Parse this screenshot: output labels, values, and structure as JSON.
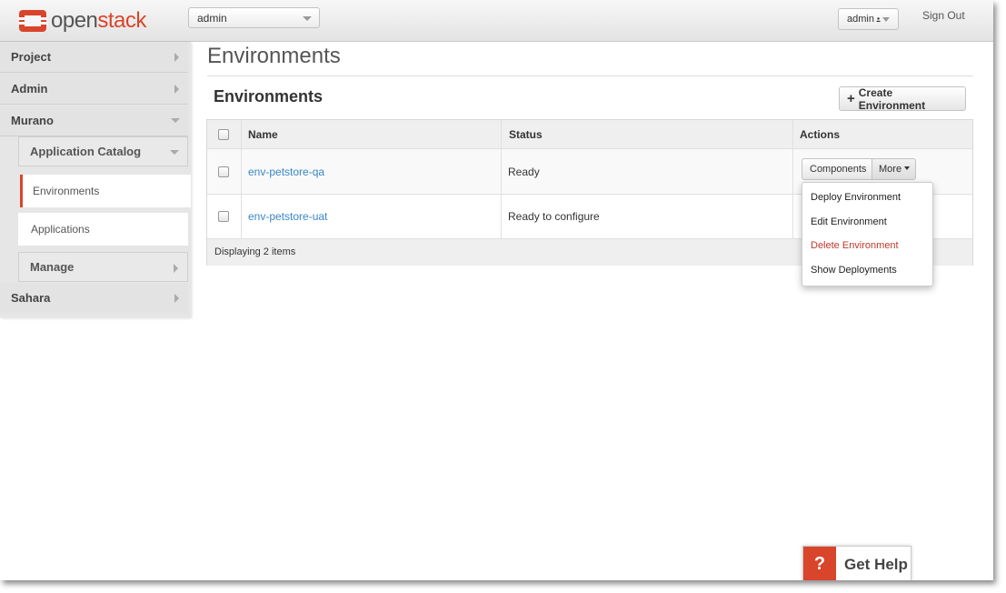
{
  "header": {
    "logo_open": "open",
    "logo_stack": "stack",
    "project_select": "admin",
    "user_menu": "admin",
    "sign_out": "Sign Out",
    "brand_color": "#d9452b"
  },
  "sidebar": {
    "sections": [
      {
        "label": "Project",
        "state": "collapsed"
      },
      {
        "label": "Admin",
        "state": "collapsed"
      },
      {
        "label": "Murano",
        "state": "expanded"
      },
      {
        "label": "Sahara",
        "state": "collapsed"
      }
    ],
    "murano": {
      "app_catalog": {
        "label": "Application Catalog",
        "state": "expanded"
      },
      "items": [
        {
          "label": "Environments",
          "active": true
        },
        {
          "label": "Applications",
          "active": false
        }
      ],
      "manage": {
        "label": "Manage",
        "state": "collapsed"
      }
    }
  },
  "main": {
    "page_title": "Environments",
    "table_title": "Environments",
    "create_button": "Create Environment",
    "table": {
      "columns": [
        "Name",
        "Status",
        "Actions"
      ],
      "rows": [
        {
          "name": "env-petstore-qa",
          "status": "Ready"
        },
        {
          "name": "env-petstore-uat",
          "status": "Ready to configure"
        }
      ],
      "footer": "Displaying 2 items"
    },
    "row_actions": {
      "primary": "Components",
      "more": "More",
      "menu": [
        "Deploy Environment",
        "Edit Environment",
        "Delete Environment",
        "Show Deployments"
      ]
    }
  },
  "help": {
    "icon": "?",
    "label": "Get Help"
  }
}
